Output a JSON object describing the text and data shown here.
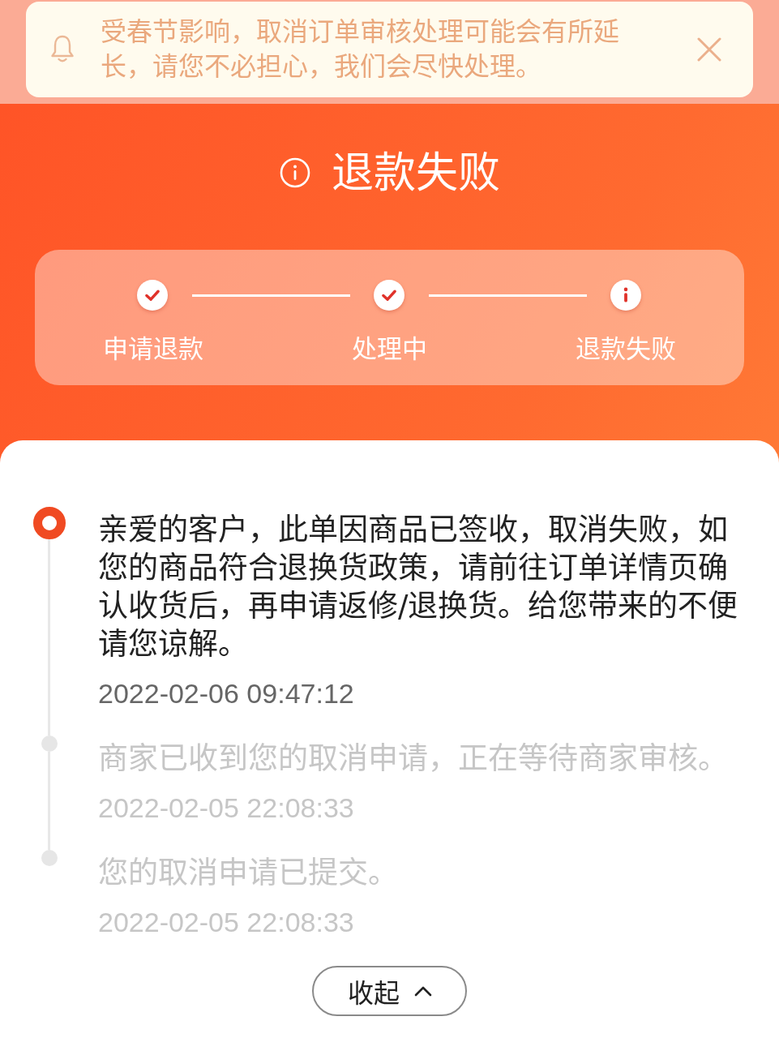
{
  "notice": {
    "text": "受春节影响，取消订单审核处理可能会有所延长，请您不必担心，我们会尽快处理。"
  },
  "status": {
    "title": "退款失败"
  },
  "steps": [
    {
      "label": "申请退款",
      "kind": "done"
    },
    {
      "label": "处理中",
      "kind": "done"
    },
    {
      "label": "退款失败",
      "kind": "failed"
    }
  ],
  "timeline": [
    {
      "text": "亲爱的客户，此单因商品已签收，取消失败，如您的商品符合退换货政策，请前往订单详情页确认收货后，再申请返修/退换货。给您带来的不便请您谅解。",
      "time": "2022-02-06 09:47:12",
      "active": true
    },
    {
      "text": "商家已收到您的取消申请，正在等待商家审核。",
      "time": "2022-02-05 22:08:33",
      "active": false
    },
    {
      "text": "您的取消申请已提交。",
      "time": "2022-02-05 22:08:33",
      "active": false
    }
  ],
  "collapse_button": {
    "label": "收起"
  }
}
